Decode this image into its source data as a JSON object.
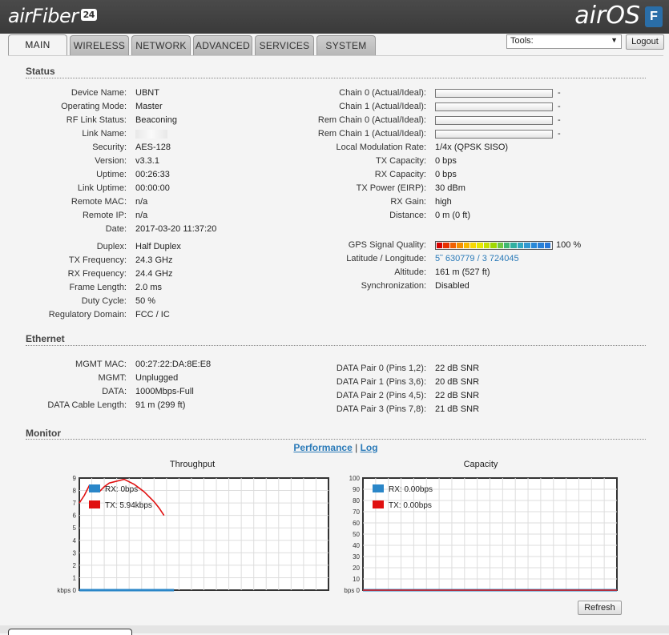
{
  "header": {
    "brand_left": "airFiber",
    "brand_left_badge": "24",
    "brand_right": "airOS",
    "brand_badge": "F",
    "tools_label": "Tools:",
    "logout_label": "Logout"
  },
  "tabs": [
    {
      "label": "MAIN",
      "active": true
    },
    {
      "label": "WIRELESS"
    },
    {
      "label": "NETWORK"
    },
    {
      "label": "ADVANCED"
    },
    {
      "label": "SERVICES"
    },
    {
      "label": "SYSTEM"
    }
  ],
  "status": {
    "title": "Status",
    "left": [
      {
        "label": "Device Name:",
        "value": "UBNT"
      },
      {
        "label": "Operating Mode:",
        "value": "Master"
      },
      {
        "label": "RF Link Status:",
        "value": "Beaconing"
      },
      {
        "label": "Link Name:",
        "value": ""
      },
      {
        "label": "Security:",
        "value": "AES-128"
      },
      {
        "label": "Version:",
        "value": "v3.3.1"
      },
      {
        "label": "Uptime:",
        "value": "00:26:33"
      },
      {
        "label": "Link Uptime:",
        "value": "00:00:00"
      },
      {
        "label": "Remote MAC:",
        "value": "n/a"
      },
      {
        "label": "Remote IP:",
        "value": "n/a"
      },
      {
        "label": "Date:",
        "value": "2017-03-20 11:37:20"
      }
    ],
    "left2": [
      {
        "label": "Duplex:",
        "value": "Half Duplex"
      },
      {
        "label": "TX Frequency:",
        "value": "24.3 GHz"
      },
      {
        "label": "RX Frequency:",
        "value": "24.4 GHz"
      },
      {
        "label": "Frame Length:",
        "value": "2.0 ms"
      },
      {
        "label": "Duty Cycle:",
        "value": "50 %"
      },
      {
        "label": "Regulatory Domain:",
        "value": "FCC / IC"
      }
    ],
    "chains": [
      {
        "label": "Chain 0 (Actual/Ideal):",
        "value": "-"
      },
      {
        "label": "Chain 1 (Actual/Ideal):",
        "value": "-"
      },
      {
        "label": "Rem Chain 0 (Actual/Ideal):",
        "value": "-"
      },
      {
        "label": "Rem Chain 1 (Actual/Ideal):",
        "value": "-"
      }
    ],
    "right": [
      {
        "label": "Local Modulation Rate:",
        "value": "1/4x (QPSK SISO)"
      },
      {
        "label": "TX Capacity:",
        "value": "0 bps"
      },
      {
        "label": "RX Capacity:",
        "value": "0 bps"
      },
      {
        "label": "TX Power (EIRP):",
        "value": "30 dBm"
      },
      {
        "label": "RX Gain:",
        "value": "high"
      },
      {
        "label": "Distance:",
        "value": "0 m (0 ft)"
      }
    ],
    "gps": {
      "label": "GPS Signal Quality:",
      "value": "100 %",
      "level": 1.0
    },
    "right2": [
      {
        "label": "Latitude / Longitude:",
        "value": "5˜ 630779 / 3   724045",
        "link": true
      },
      {
        "label": "Altitude:",
        "value": "161 m (527 ft)"
      },
      {
        "label": "Synchronization:",
        "value": "Disabled"
      }
    ]
  },
  "ethernet": {
    "title": "Ethernet",
    "left": [
      {
        "label": "MGMT MAC:",
        "value": "00:27:22:DA:8E:E8"
      },
      {
        "label": "MGMT:",
        "value": "Unplugged"
      },
      {
        "label": "DATA:",
        "value": "1000Mbps-Full"
      },
      {
        "label": "DATA Cable Length:",
        "value": "91 m (299 ft)"
      }
    ],
    "right": [
      {
        "label": "DATA Pair 0 (Pins 1,2):",
        "value": "22 dB SNR"
      },
      {
        "label": "DATA Pair 1 (Pins 3,6):",
        "value": "20 dB SNR"
      },
      {
        "label": "DATA Pair 2 (Pins 4,5):",
        "value": "22 dB SNR"
      },
      {
        "label": "DATA Pair 3 (Pins 7,8):",
        "value": "21 dB SNR"
      }
    ]
  },
  "monitor": {
    "title": "Monitor",
    "link_performance": "Performance",
    "separator": "|",
    "link_log": "Log",
    "refresh_label": "Refresh"
  },
  "colors": {
    "rx": "#2a86c8",
    "tx": "#e01010"
  },
  "chart_data": [
    {
      "type": "line",
      "title": "Throughput",
      "ylabel_unit": "kbps",
      "ylim": [
        0,
        9
      ],
      "yticks": [
        0,
        1,
        2,
        3,
        4,
        5,
        6,
        7,
        8,
        9
      ],
      "grid": true,
      "legend_placement": "top-left",
      "x": [
        0,
        1,
        2,
        3,
        4,
        5,
        6,
        7,
        8,
        9,
        10,
        11,
        12,
        13,
        14,
        15,
        16,
        17,
        18,
        19,
        20,
        21,
        22,
        23,
        24,
        25,
        26,
        27,
        28,
        29,
        30,
        31,
        32,
        33,
        34,
        35,
        36,
        37,
        38,
        39,
        40,
        41,
        42,
        43,
        44,
        45,
        46,
        47,
        48,
        49,
        50
      ],
      "series": [
        {
          "name": "RX: 0bps",
          "color": "#2a86c8",
          "values": [
            0,
            0,
            0,
            0,
            0,
            0,
            0,
            0,
            0,
            0,
            0,
            0,
            0,
            0,
            0,
            0,
            0,
            0,
            0,
            0
          ]
        },
        {
          "name": "TX: 5.94kbps",
          "color": "#e01010",
          "values": [
            7.0,
            7.6,
            8.4,
            8.1,
            7.9,
            8.3,
            8.6,
            8.7,
            8.8,
            8.9,
            8.7,
            8.5,
            8.2,
            7.9,
            7.5,
            7.1,
            6.6,
            6.0
          ]
        }
      ]
    },
    {
      "type": "line",
      "title": "Capacity",
      "ylabel_unit": "bps",
      "ylim": [
        0,
        100
      ],
      "yticks": [
        0,
        10,
        20,
        30,
        40,
        50,
        60,
        70,
        80,
        90,
        100
      ],
      "grid": true,
      "legend_placement": "top-left",
      "series": [
        {
          "name": "RX: 0.00bps",
          "color": "#2a86c8",
          "values": [
            0,
            0
          ]
        },
        {
          "name": "TX: 0.00bps",
          "color": "#e01010",
          "values": [
            0,
            0
          ]
        }
      ]
    }
  ]
}
